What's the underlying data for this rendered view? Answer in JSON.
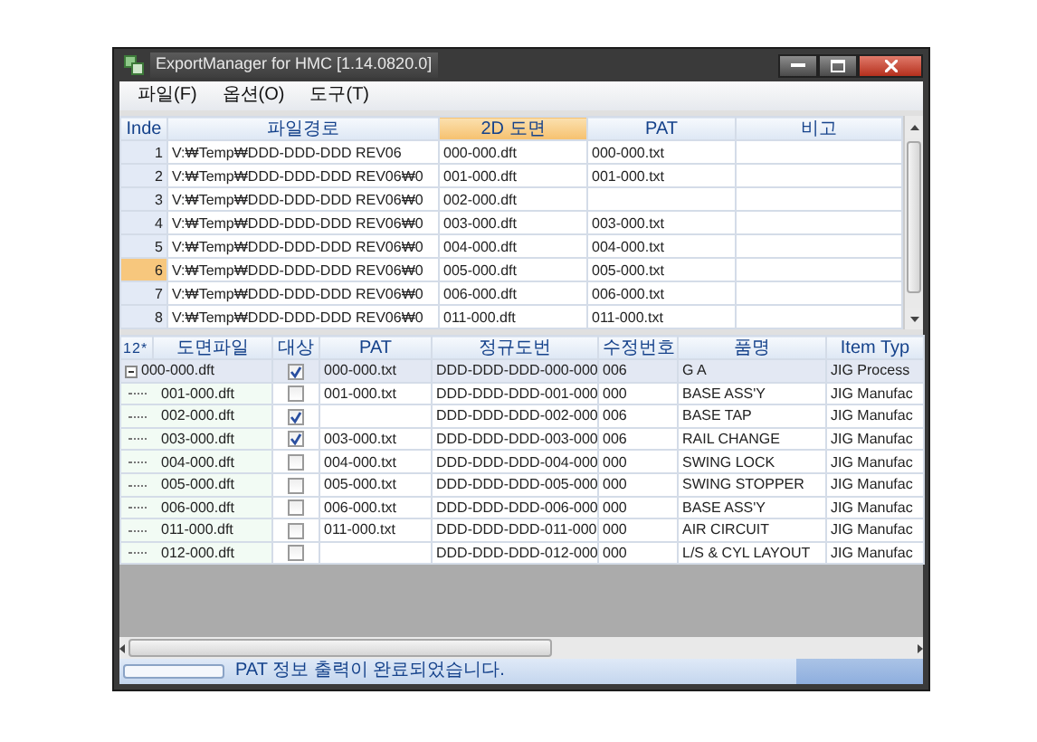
{
  "window": {
    "title": "ExportManager for HMC [1.14.0820.0]"
  },
  "menu": [
    {
      "label": "파일(F)"
    },
    {
      "label": "옵션(O)"
    },
    {
      "label": "도구(T)"
    }
  ],
  "file_grid": {
    "columns": [
      {
        "label": "Inde",
        "selected": false
      },
      {
        "label": "파일경로",
        "selected": false
      },
      {
        "label": "2D 도면",
        "selected": true
      },
      {
        "label": "PAT",
        "selected": false
      },
      {
        "label": "비고",
        "selected": false
      }
    ],
    "rows": [
      {
        "index": "1",
        "path": "V:₩Temp₩DDD-DDD-DDD REV06",
        "drawing": "000-000.dft",
        "pat": "000-000.txt",
        "selected": false
      },
      {
        "index": "2",
        "path": "V:₩Temp₩DDD-DDD-DDD REV06₩0",
        "drawing": "001-000.dft",
        "pat": "001-000.txt",
        "selected": false
      },
      {
        "index": "3",
        "path": "V:₩Temp₩DDD-DDD-DDD REV06₩0",
        "drawing": "002-000.dft",
        "selected": false
      },
      {
        "index": "4",
        "path": "V:₩Temp₩DDD-DDD-DDD REV06₩0",
        "drawing": "003-000.dft",
        "pat": "003-000.txt",
        "selected": false
      },
      {
        "index": "5",
        "path": "V:₩Temp₩DDD-DDD-DDD REV06₩0",
        "drawing": "004-000.dft",
        "pat": "004-000.txt",
        "selected": false
      },
      {
        "index": "6",
        "path": "V:₩Temp₩DDD-DDD-DDD REV06₩0",
        "drawing": "005-000.dft",
        "pat": "005-000.txt",
        "selected": true
      },
      {
        "index": "7",
        "path": "V:₩Temp₩DDD-DDD-DDD REV06₩0",
        "drawing": "006-000.dft",
        "pat": "006-000.txt",
        "selected": false
      },
      {
        "index": "8",
        "path": "V:₩Temp₩DDD-DDD-DDD REV06₩0",
        "drawing": "011-000.dft",
        "pat": "011-000.txt",
        "selected": false
      }
    ]
  },
  "tree_grid": {
    "level_buttons": [
      "1",
      "2",
      "*"
    ],
    "columns": [
      "도면파일",
      "대상",
      "PAT",
      "정규도번",
      "수정번호",
      "품명",
      "Item Typ"
    ],
    "rows": [
      {
        "file": "000-000.dft",
        "target": true,
        "pat": "000-000.txt",
        "number": "DDD-DDD-DDD-000-000",
        "revision": "006",
        "name": "G A",
        "item_type": "JIG Process",
        "expanded": true,
        "selected": true,
        "children": [
          {
            "file": "001-000.dft",
            "target": false,
            "pat": "001-000.txt",
            "number": "DDD-DDD-DDD-001-000",
            "revision": "000",
            "name": "BASE ASS'Y",
            "item_type": "JIG Manufac",
            "selected": false
          },
          {
            "file": "002-000.dft",
            "target": true,
            "number": "DDD-DDD-DDD-002-000",
            "revision": "006",
            "name": "BASE TAP",
            "item_type": "JIG Manufac",
            "selected": false
          },
          {
            "file": "003-000.dft",
            "target": true,
            "pat": "003-000.txt",
            "number": "DDD-DDD-DDD-003-000",
            "revision": "006",
            "name": "RAIL CHANGE",
            "item_type": "JIG Manufac",
            "selected": false
          },
          {
            "file": "004-000.dft",
            "target": false,
            "pat": "004-000.txt",
            "number": "DDD-DDD-DDD-004-000",
            "revision": "000",
            "name": "SWING LOCK",
            "item_type": "JIG Manufac",
            "selected": false
          },
          {
            "file": "005-000.dft",
            "target": false,
            "pat": "005-000.txt",
            "number": "DDD-DDD-DDD-005-000",
            "revision": "000",
            "name": "SWING STOPPER",
            "item_type": "JIG Manufac",
            "selected": false
          },
          {
            "file": "006-000.dft",
            "target": false,
            "pat": "006-000.txt",
            "number": "DDD-DDD-DDD-006-000",
            "revision": "000",
            "name": "BASE ASS'Y",
            "item_type": "JIG Manufac",
            "selected": false
          },
          {
            "file": "011-000.dft",
            "target": false,
            "pat": "011-000.txt",
            "number": "DDD-DDD-DDD-011-000",
            "revision": "000",
            "name": "AIR CIRCUIT",
            "item_type": "JIG Manufac",
            "selected": false
          },
          {
            "file": "012-000.dft",
            "target": false,
            "number": "DDD-DDD-DDD-012-000",
            "revision": "000",
            "name": "L/S & CYL LAYOUT",
            "item_type": "JIG Manufac",
            "selected": false
          }
        ]
      }
    ]
  },
  "status_bar": {
    "progress": {
      "level": 0
    },
    "message": "PAT 정보 출력이 완료되었습니다."
  }
}
